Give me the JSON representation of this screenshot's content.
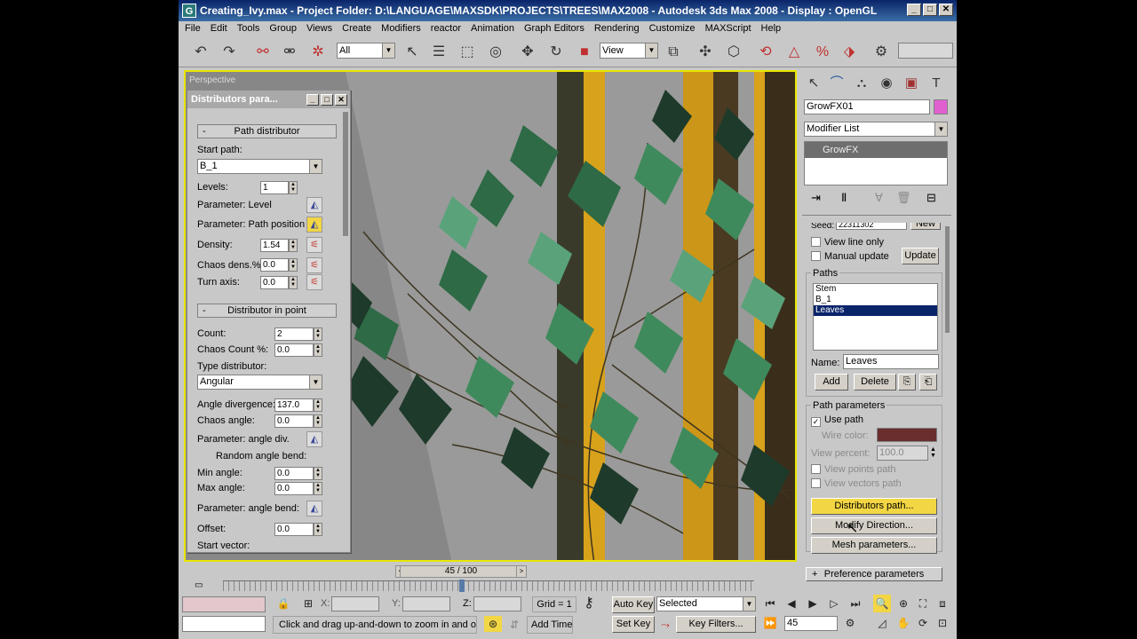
{
  "window": {
    "title": "Creating_Ivy.max    - Project Folder: D:\\LANGUAGE\\MAXSDK\\PROJECTS\\TREES\\MAX2008    - Autodesk 3ds Max 2008    - Display : OpenGL",
    "logo_letter": "G",
    "min": "_",
    "max": "□",
    "close": "✕"
  },
  "menu": [
    "File",
    "Edit",
    "Tools",
    "Group",
    "Views",
    "Create",
    "Modifiers",
    "reactor",
    "Animation",
    "Graph Editors",
    "Rendering",
    "Customize",
    "MAXScript",
    "Help"
  ],
  "toolbar": {
    "selection_filter": "All",
    "ref_coord": "View"
  },
  "viewport": {
    "label": "Perspective"
  },
  "distributors_panel": {
    "title": "Distributors para...",
    "path_distributor": {
      "header": "Path distributor",
      "collapse": "-",
      "start_path_label": "Start path:",
      "start_path_value": "B_1",
      "levels_label": "Levels:",
      "levels_value": "1",
      "param_level_label": "Parameter: Level",
      "param_path_pos_label": "Parameter: Path position",
      "density_label": "Density:",
      "density_value": "1.54",
      "chaos_dens_label": "Chaos dens.%:",
      "chaos_dens_value": "0.0",
      "turn_axis_label": "Turn axis:",
      "turn_axis_value": "0.0"
    },
    "distributor_in_point": {
      "header": "Distributor in point",
      "collapse": "-",
      "count_label": "Count:",
      "count_value": "2",
      "chaos_count_label": "Chaos Count %:",
      "chaos_count_value": "0.0",
      "type_label": "Type distributor:",
      "type_value": "Angular",
      "angle_div_label": "Angle divergence:",
      "angle_div_value": "137.0",
      "chaos_angle_label": "Chaos angle:",
      "chaos_angle_value": "0.0",
      "param_angle_div_label": "Parameter: angle div.",
      "random_bend_label": "Random angle bend:",
      "min_angle_label": "Min angle:",
      "min_angle_value": "0.0",
      "max_angle_label": "Max angle:",
      "max_angle_value": "0.0",
      "param_angle_bend_label": "Parameter: angle bend:",
      "offset_label": "Offset:",
      "offset_value": "0.0",
      "start_vector_label": "Start vector:"
    }
  },
  "command_panel": {
    "object_name": "GrowFX01",
    "object_color": "#e060d0",
    "modifier_list": "Modifier List",
    "stack_item": "GrowFX",
    "seed_label": "Seed:",
    "seed_value": "22311302",
    "new_button": "New",
    "view_line_only": "View line only",
    "manual_update": "Manual update",
    "update_button": "Update",
    "paths_group": "Paths",
    "paths": [
      "Stem",
      "B_1",
      "Leaves"
    ],
    "selected_path_index": 2,
    "name_label": "Name:",
    "name_value": "Leaves",
    "add_button": "Add",
    "delete_button": "Delete",
    "path_params_group": "Path parameters",
    "use_path": "Use path",
    "wire_color_label": "Wire color:",
    "wire_color": "#6b2e2e",
    "view_percent_label": "View percent:",
    "view_percent_value": "100.0",
    "view_points_path": "View points path",
    "view_vectors_path": "View vectors path",
    "distributors_button": "Distributors path...",
    "modify_direction_button": "Modify Direction...",
    "mesh_params_button": "Mesh parameters...",
    "preference_rollout": "Preference parameters",
    "preference_expand": "+"
  },
  "timeline": {
    "frame_label": "45 / 100"
  },
  "status": {
    "prompt": "Click and drag up-and-down to zoom in and out",
    "x_label": "X:",
    "y_label": "Y:",
    "z_label": "Z:",
    "grid_label": "Grid = 1",
    "auto_key": "Auto Key",
    "set_key": "Set Key",
    "selected_value": "Selected",
    "key_filters": "Key Filters...",
    "add_time_tag": "Add Time Tag",
    "frame_value": "45"
  }
}
